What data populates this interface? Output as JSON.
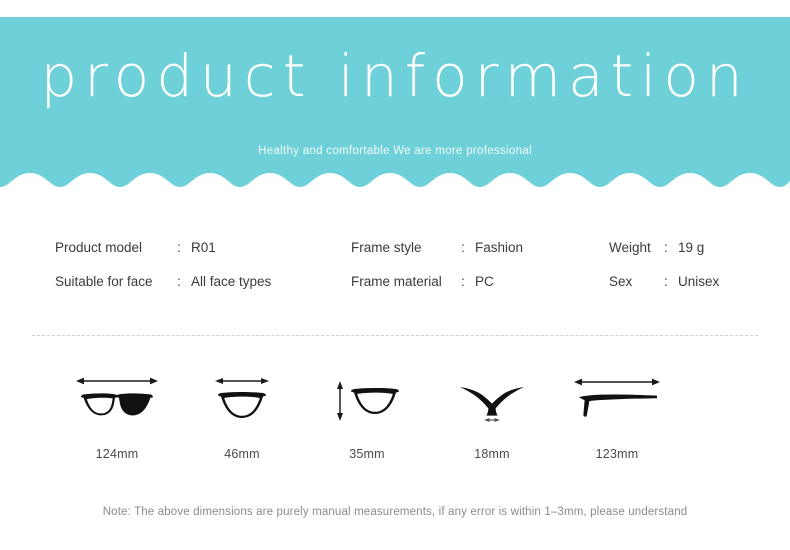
{
  "header": {
    "title": "product information",
    "subtitle": "Healthy and comfortable We are more professional",
    "background_color": "#6ed0d8",
    "text_color": "#ffffff"
  },
  "specs": {
    "rows": [
      {
        "cells": [
          {
            "label": "Product model",
            "colon": ":",
            "value": "R01"
          },
          {
            "label": "Frame style",
            "colon": ":",
            "value": "Fashion"
          },
          {
            "label": "Weight",
            "colon": ":",
            "value": "19 g"
          }
        ]
      },
      {
        "cells": [
          {
            "label": "Suitable for face",
            "colon": ":",
            "value": "All face types"
          },
          {
            "label": "Frame material",
            "colon": ":",
            "value": "PC"
          },
          {
            "label": "Sex",
            "colon": ":",
            "value": "Unisex"
          }
        ]
      }
    ]
  },
  "measurements": [
    {
      "icon": "glasses-front-icon",
      "label": "124mm"
    },
    {
      "icon": "lens-width-icon",
      "label": "46mm"
    },
    {
      "icon": "lens-height-icon",
      "label": "35mm"
    },
    {
      "icon": "bridge-width-icon",
      "label": "18mm"
    },
    {
      "icon": "temple-arm-icon",
      "label": "123mm"
    }
  ],
  "footer": {
    "note": "Note: The above dimensions are purely manual measurements, if any error is within 1–3mm, please understand"
  }
}
